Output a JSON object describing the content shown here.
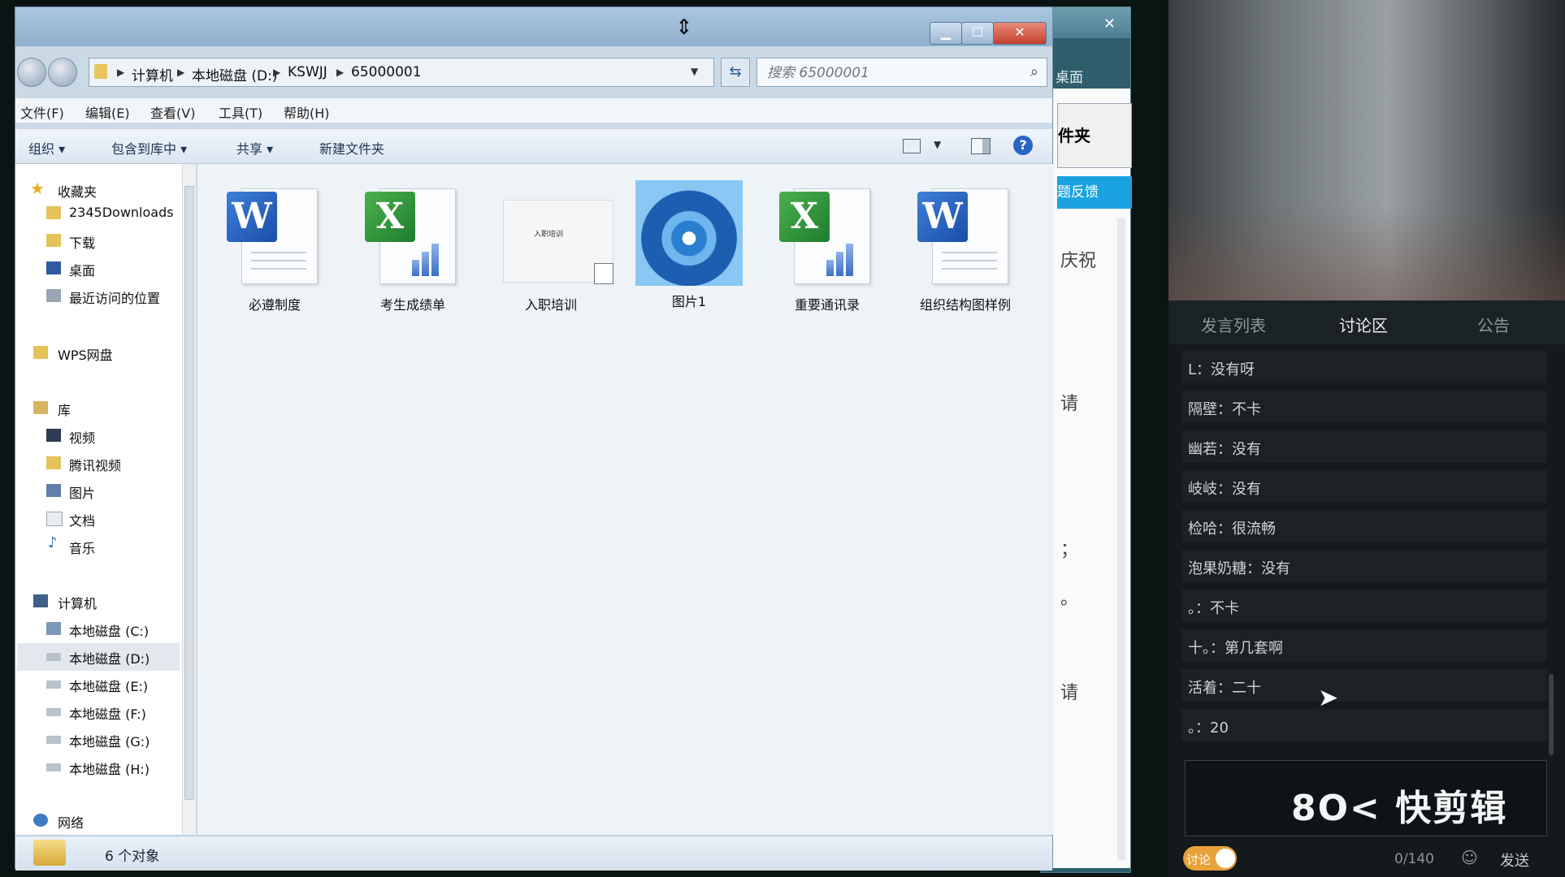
{
  "explorer": {
    "window_controls": {
      "minimize": "▁",
      "maximize": "☐",
      "close": "✕"
    },
    "breadcrumb": [
      "计算机",
      "本地磁盘 (D:)",
      "KSWJJ",
      "65000001"
    ],
    "search_placeholder": "搜索 65000001",
    "menu": [
      "文件(F)",
      "编辑(E)",
      "查看(V)",
      "工具(T)",
      "帮助(H)"
    ],
    "toolbar": {
      "organize": "组织 ▾",
      "include": "包含到库中 ▾",
      "share": "共享 ▾",
      "new_folder": "新建文件夹"
    },
    "nav": {
      "favorites": "收藏夹",
      "fav_items": [
        "2345Downloads",
        "下载",
        "桌面",
        "最近访问的位置"
      ],
      "wps": "WPS网盘",
      "library": "库",
      "lib_items": [
        "视频",
        "腾讯视频",
        "图片",
        "文档",
        "音乐"
      ],
      "computer": "计算机",
      "drives": [
        "本地磁盘 (C:)",
        "本地磁盘 (D:)",
        "本地磁盘 (E:)",
        "本地磁盘 (F:)",
        "本地磁盘 (G:)",
        "本地磁盘 (H:)"
      ],
      "network": "网络"
    },
    "files": [
      {
        "name": "必遵制度",
        "type": "word"
      },
      {
        "name": "考生成绩单",
        "type": "excel"
      },
      {
        "name": "入职培训",
        "type": "slide"
      },
      {
        "name": "图片1",
        "type": "image"
      },
      {
        "name": "重要通讯录",
        "type": "excel"
      },
      {
        "name": "组织结构图样例",
        "type": "word"
      }
    ],
    "slide_thumb_title": "入职培训",
    "status": "6 个对象"
  },
  "behind_window": {
    "close": "✕",
    "text_top": "桌面",
    "button": "件夹",
    "blue_button": "题反馈",
    "t1": "庆祝",
    "t2": "请",
    "t3": "；",
    "t4": "。",
    "t5": "请"
  },
  "chat": {
    "tabs": [
      "发言列表",
      "讨论区",
      "公告"
    ],
    "messages": [
      "L：没有呀",
      "隔壁：不卡",
      "幽若：没有",
      "岐岐：没有",
      "检哈：很流畅",
      "泡果奶糖：没有",
      "。：不卡",
      "十。：第几套啊",
      "活着：二十",
      "。：20"
    ],
    "watermark": "8O< 快剪辑",
    "toggle_label": "讨论",
    "char_count": "0/140",
    "send": "发送",
    "colors": {
      "accent": "#e8a23a",
      "panel_bg": "#14191c"
    }
  }
}
